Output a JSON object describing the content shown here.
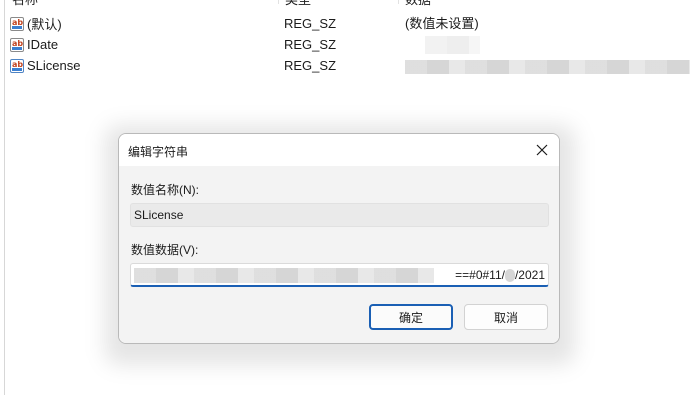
{
  "columns": {
    "name": "名称",
    "type": "类型",
    "data": "数据"
  },
  "rows": [
    {
      "name": "(默认)",
      "type": "REG_SZ",
      "data": "(数值未设置)",
      "icon": "string-value-icon"
    },
    {
      "name": "IDate",
      "type": "REG_SZ",
      "data": "",
      "icon": "string-value-icon"
    },
    {
      "name": "SLicense",
      "type": "REG_SZ",
      "data": "",
      "icon": "string-value-icon"
    }
  ],
  "dialog": {
    "title": "编辑字符串",
    "value_name_label": "数值名称(N):",
    "value_name": "SLicense",
    "value_data_label": "数值数据(V):",
    "value_data_visible_suffix": "==#0#11/",
    "value_data_visible_tail": "/2021",
    "ok_label": "确定",
    "cancel_label": "取消"
  },
  "colors": {
    "accent": "#1a5fb4",
    "dialog_body": "#f3f3f3",
    "readonly_field": "#eaeaea"
  }
}
